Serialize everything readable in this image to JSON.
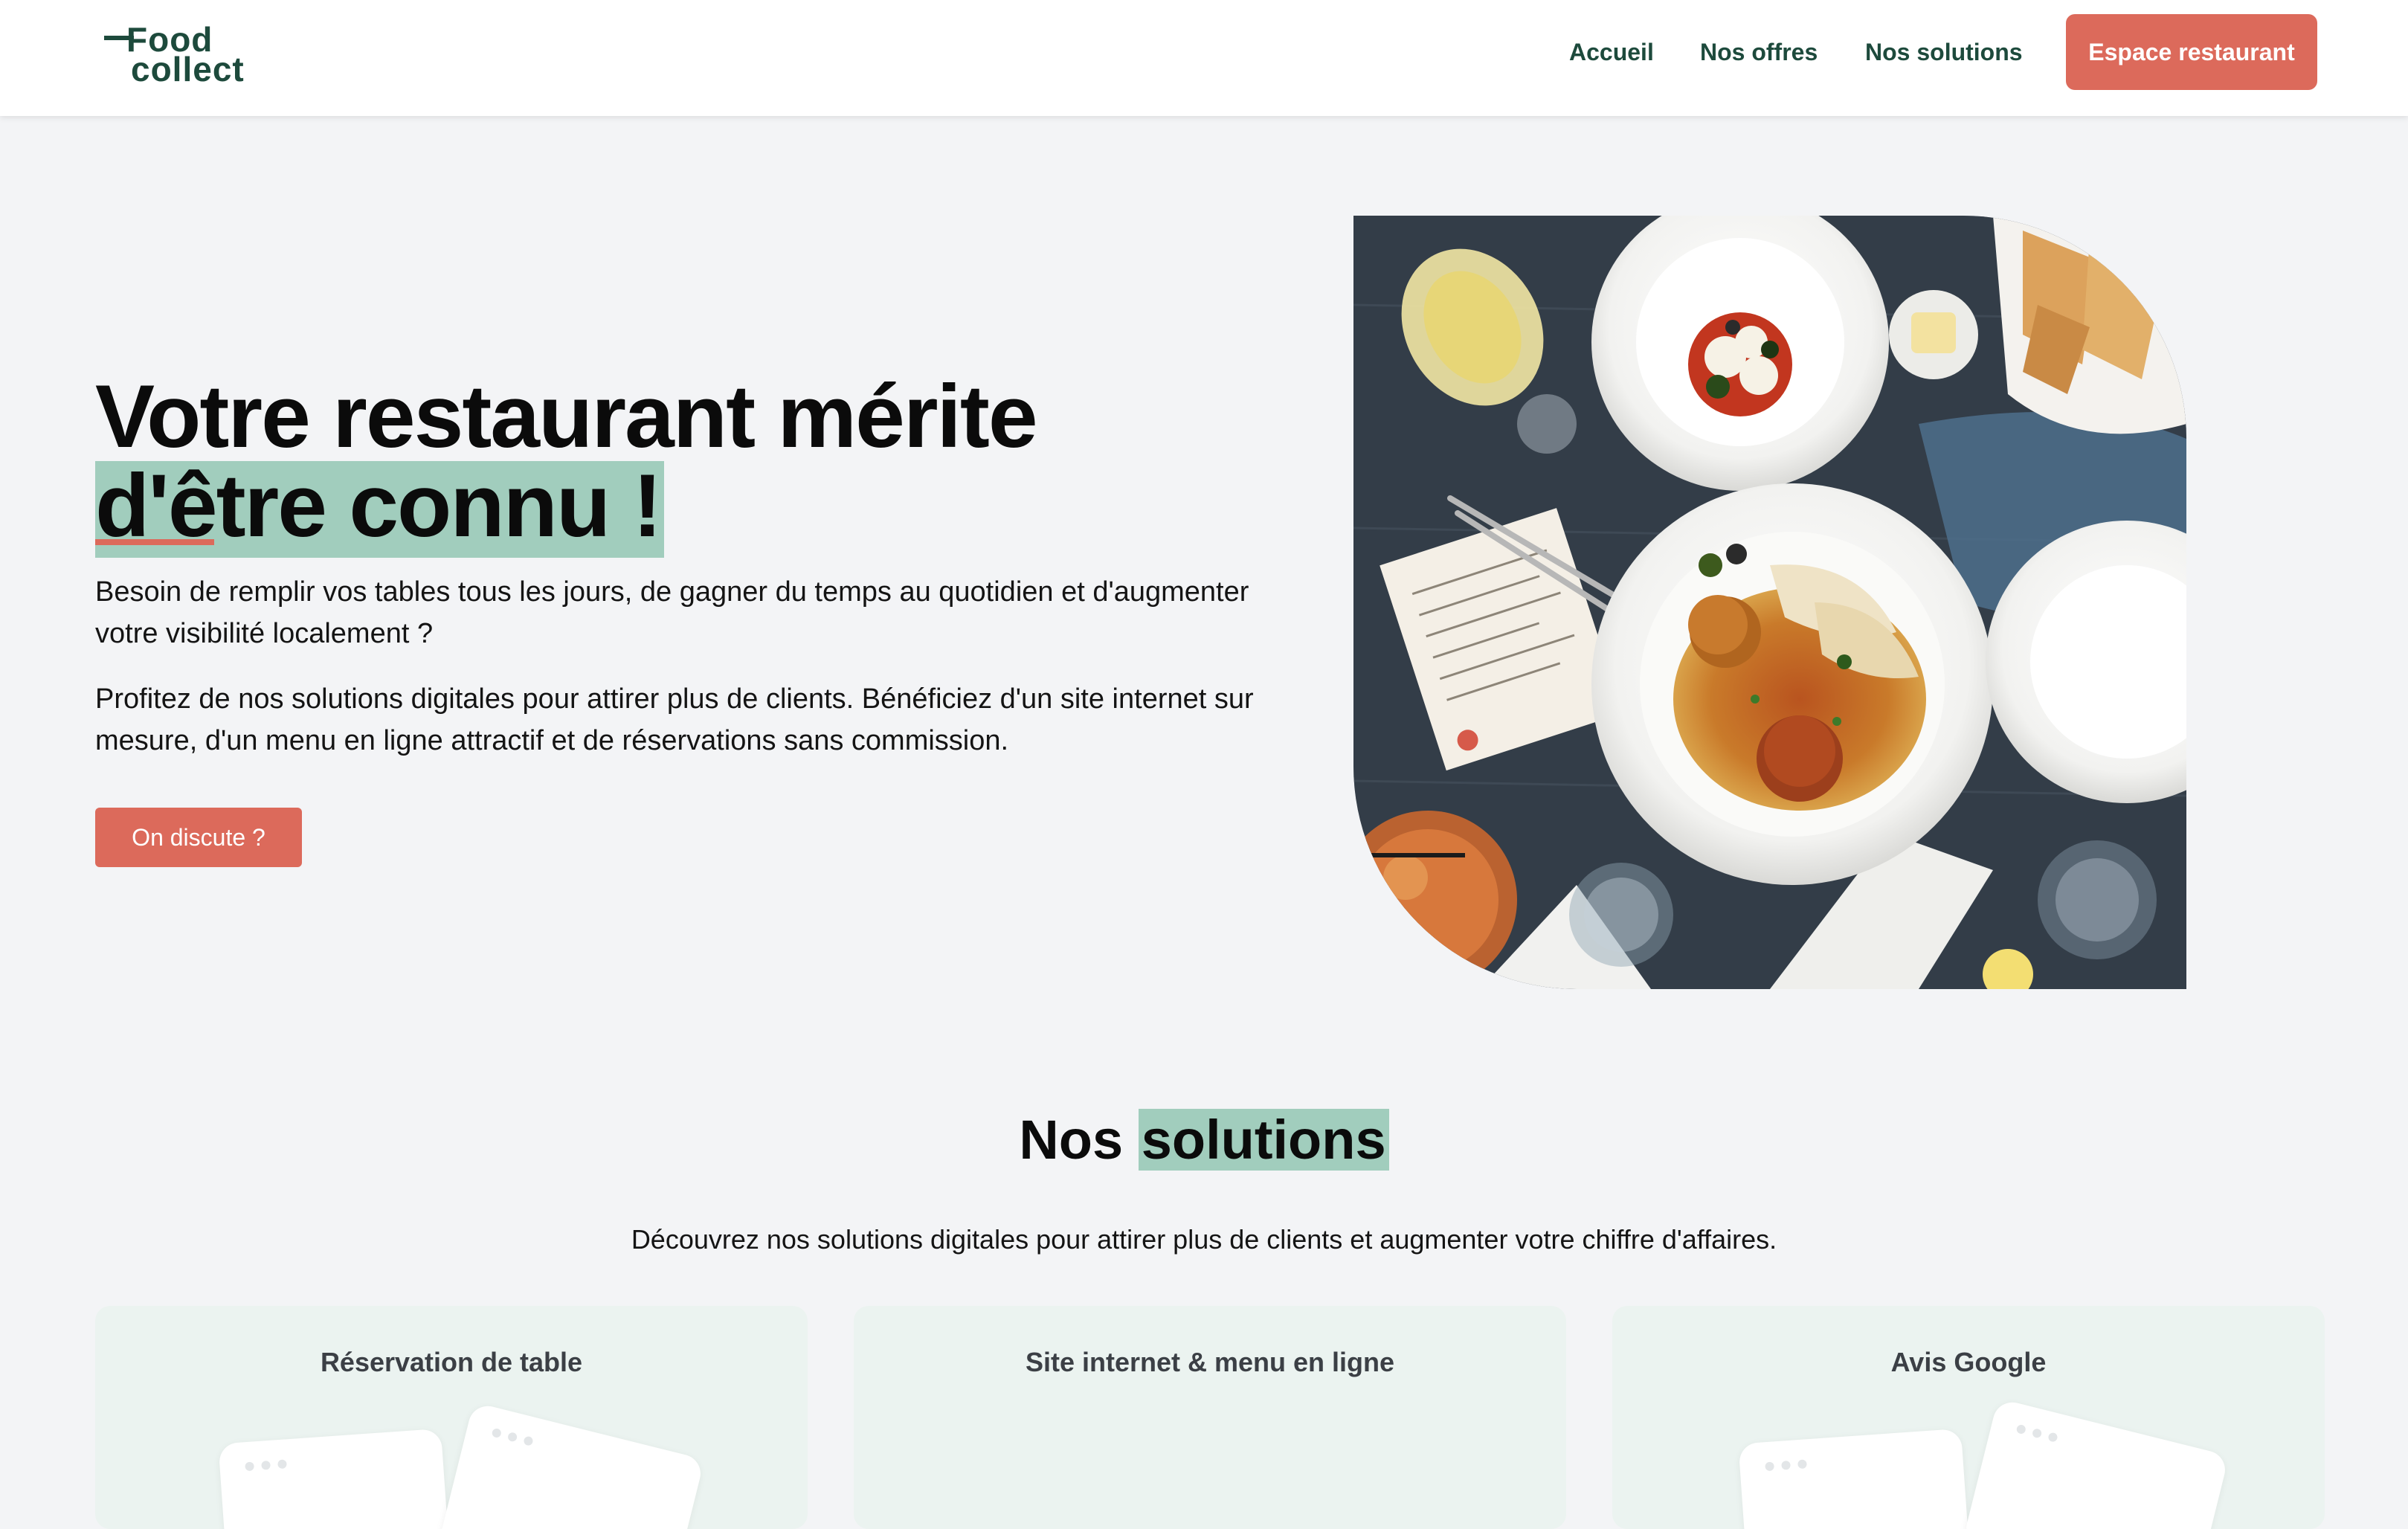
{
  "header": {
    "logo_line1": "Food",
    "logo_line2": "collect",
    "nav": [
      "Accueil",
      "Nos offres",
      "Nos solutions"
    ],
    "cta": "Espace restaurant"
  },
  "hero": {
    "title_line1": "Votre restaurant mérite",
    "title_line2": "d'être connu !",
    "paragraph1": "Besoin de remplir vos tables tous les jours, de gagner du temps au quotidien et d'augmenter votre visibilité localement ?",
    "paragraph2": "Profitez de nos solutions digitales pour attirer plus de clients. Bénéficiez d'un site internet sur mesure, d'un menu en ligne attractif et de réservations sans commission.",
    "button": "On discute ?"
  },
  "solutions": {
    "title_plain": "Nos",
    "title_highlight": "solutions",
    "subtitle": "Découvrez nos solutions digitales pour attirer plus de clients et augmenter votre chiffre d'affaires.",
    "cards": [
      {
        "title": "Réservation de table"
      },
      {
        "title": "Site internet & menu en ligne"
      },
      {
        "title": "Avis Google"
      }
    ]
  },
  "colors": {
    "brand_green": "#1d4a3c",
    "accent_coral": "#dc6a5b",
    "highlight_mint": "#a1cdbd",
    "page_bg": "#f3f4f6",
    "card_bg": "#ebf3f0"
  }
}
